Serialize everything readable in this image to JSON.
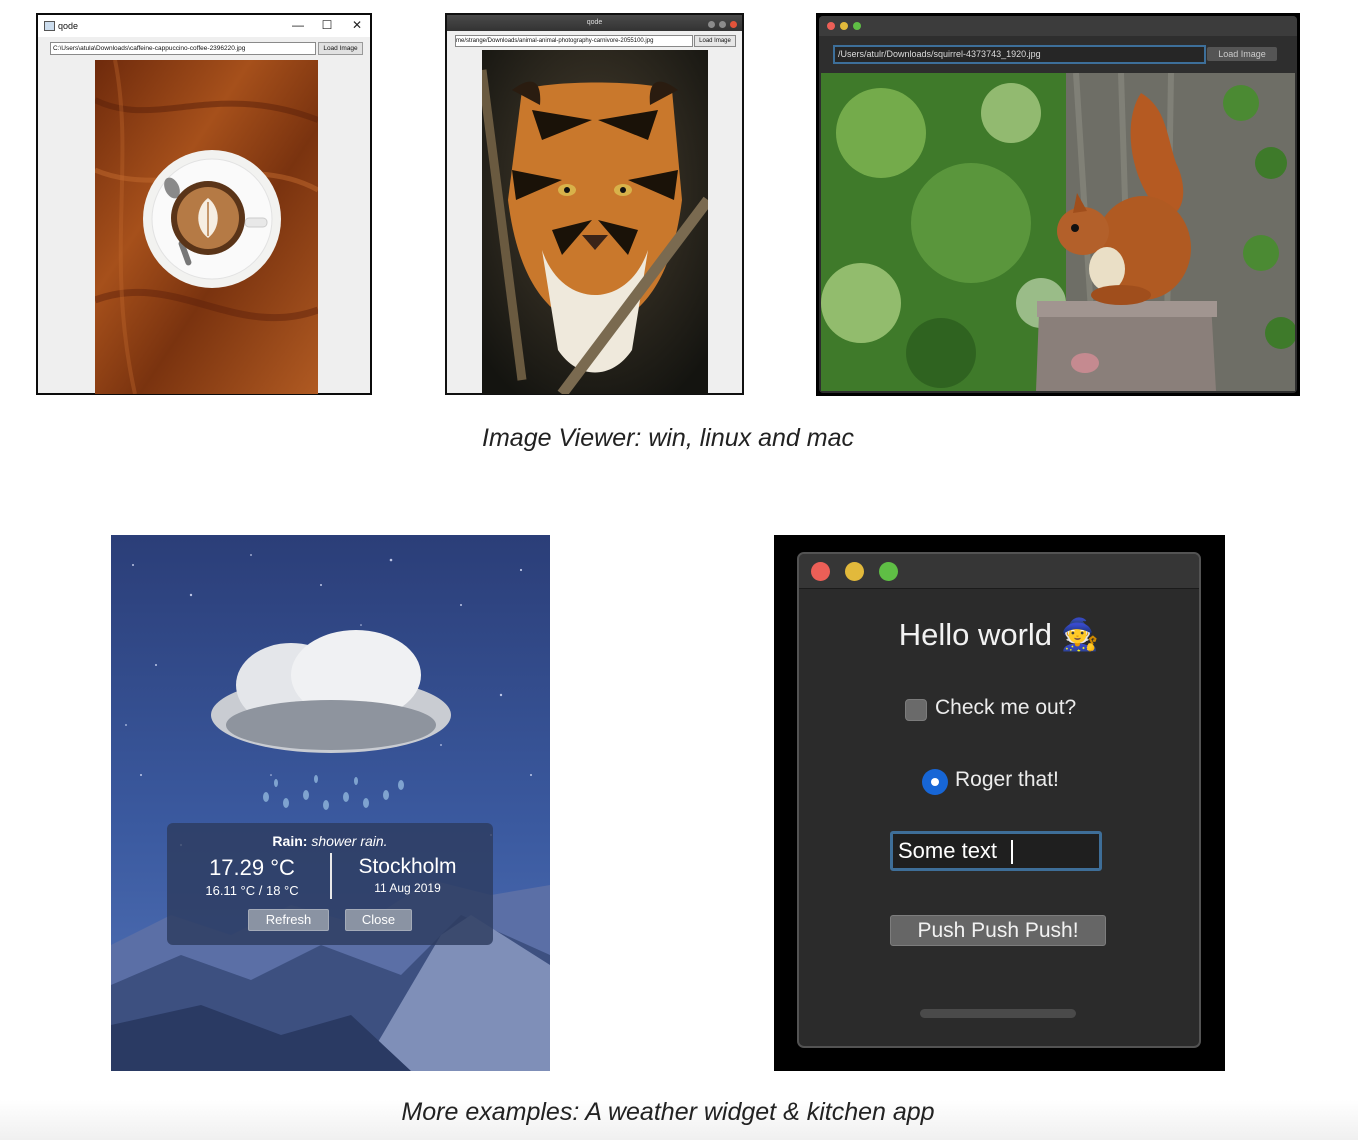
{
  "windows_viewer": {
    "title": "qode",
    "minimize_glyph": "—",
    "maximize_glyph": "☐",
    "close_glyph": "✕",
    "path": "C:\\Users\\atula\\Downloads\\caffeine-cappuccino-coffee-2396220.jpg",
    "load_label": "Load Image"
  },
  "linux_viewer": {
    "title": "qode",
    "path": "me/strange/Downloads/animal-animal-photography-carnivore-2055100.jpg",
    "load_label": "Load Image"
  },
  "mac_viewer": {
    "path": "/Users/atulr/Downloads/squirrel-4373743_1920.jpg",
    "load_label": "Load Image"
  },
  "caption_top": "Image Viewer: win, linux and mac",
  "weather": {
    "condition": "Rain:",
    "description": "shower rain.",
    "temperature": "17.29 °C",
    "min_max": "16.11 °C / 18 °C",
    "city": "Stockholm",
    "date": "11 Aug 2019",
    "refresh_label": "Refresh",
    "close_label": "Close"
  },
  "kitchen": {
    "hello": "Hello world",
    "hello_emoji": "🧙",
    "checkbox_label": "Check me out?",
    "radio_label": "Roger that!",
    "input_value": "Some text",
    "button_label": "Push Push Push!"
  },
  "caption_bottom": "More examples: A weather widget & kitchen app",
  "colors": {
    "mac_red": "#ec5f57",
    "mac_yellow": "#e2b93b",
    "mac_green": "#5fbe45",
    "radio_blue": "#1766d6",
    "input_focus": "#3e6e98"
  }
}
